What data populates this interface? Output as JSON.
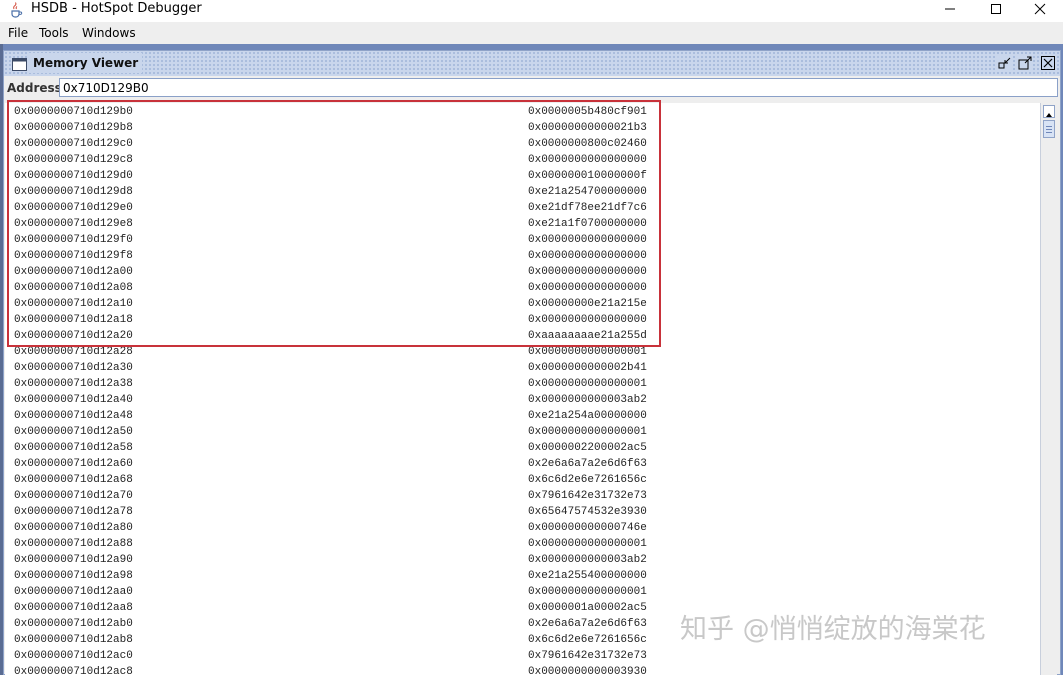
{
  "window": {
    "title": "HSDB - HotSpot Debugger"
  },
  "menu": {
    "items": [
      {
        "label": "File"
      },
      {
        "label": "Tools"
      },
      {
        "label": "Windows"
      }
    ]
  },
  "frame": {
    "title": "Memory Viewer"
  },
  "address": {
    "label": "Address:",
    "value": "0x710D129B0"
  },
  "memory": {
    "rows": [
      {
        "address": "0x0000000710d129b0",
        "value": "0x0000005b480cf901"
      },
      {
        "address": "0x0000000710d129b8",
        "value": "0x00000000000021b3"
      },
      {
        "address": "0x0000000710d129c0",
        "value": "0x0000000800c02460"
      },
      {
        "address": "0x0000000710d129c8",
        "value": "0x0000000000000000"
      },
      {
        "address": "0x0000000710d129d0",
        "value": "0x000000010000000f"
      },
      {
        "address": "0x0000000710d129d8",
        "value": "0xe21a254700000000"
      },
      {
        "address": "0x0000000710d129e0",
        "value": "0xe21df78ee21df7c6"
      },
      {
        "address": "0x0000000710d129e8",
        "value": "0xe21a1f0700000000"
      },
      {
        "address": "0x0000000710d129f0",
        "value": "0x0000000000000000"
      },
      {
        "address": "0x0000000710d129f8",
        "value": "0x0000000000000000"
      },
      {
        "address": "0x0000000710d12a00",
        "value": "0x0000000000000000"
      },
      {
        "address": "0x0000000710d12a08",
        "value": "0x0000000000000000"
      },
      {
        "address": "0x0000000710d12a10",
        "value": "0x00000000e21a215e"
      },
      {
        "address": "0x0000000710d12a18",
        "value": "0x0000000000000000"
      },
      {
        "address": "0x0000000710d12a20",
        "value": "0xaaaaaaaae21a255d"
      },
      {
        "address": "0x0000000710d12a28",
        "value": "0x0000000000000001"
      },
      {
        "address": "0x0000000710d12a30",
        "value": "0x0000000000002b41"
      },
      {
        "address": "0x0000000710d12a38",
        "value": "0x0000000000000001"
      },
      {
        "address": "0x0000000710d12a40",
        "value": "0x0000000000003ab2"
      },
      {
        "address": "0x0000000710d12a48",
        "value": "0xe21a254a00000000"
      },
      {
        "address": "0x0000000710d12a50",
        "value": "0x0000000000000001"
      },
      {
        "address": "0x0000000710d12a58",
        "value": "0x0000002200002ac5"
      },
      {
        "address": "0x0000000710d12a60",
        "value": "0x2e6a6a7a2e6d6f63"
      },
      {
        "address": "0x0000000710d12a68",
        "value": "0x6c6d2e6e7261656c"
      },
      {
        "address": "0x0000000710d12a70",
        "value": "0x7961642e31732e73"
      },
      {
        "address": "0x0000000710d12a78",
        "value": "0x65647574532e3930"
      },
      {
        "address": "0x0000000710d12a80",
        "value": "0x000000000000746e"
      },
      {
        "address": "0x0000000710d12a88",
        "value": "0x0000000000000001"
      },
      {
        "address": "0x0000000710d12a90",
        "value": "0x0000000000003ab2"
      },
      {
        "address": "0x0000000710d12a98",
        "value": "0xe21a255400000000"
      },
      {
        "address": "0x0000000710d12aa0",
        "value": "0x0000000000000001"
      },
      {
        "address": "0x0000000710d12aa8",
        "value": "0x0000001a00002ac5"
      },
      {
        "address": "0x0000000710d12ab0",
        "value": "0x2e6a6a7a2e6d6f63"
      },
      {
        "address": "0x0000000710d12ab8",
        "value": "0x6c6d2e6e7261656c"
      },
      {
        "address": "0x0000000710d12ac0",
        "value": "0x7961642e31732e73"
      },
      {
        "address": "0x0000000710d12ac8",
        "value": "0x0000000000003930"
      }
    ]
  },
  "watermark": {
    "text": "知乎 @悄悄绽放的海棠花"
  },
  "icons": {
    "app": "java-cup-icon",
    "frame": "window-icon",
    "minimize": "minimize-icon",
    "maximize": "maximize-icon",
    "close": "close-icon",
    "frame_iconify": "iconify-icon",
    "frame_maximize": "frame-maximize-icon",
    "frame_close": "frame-close-icon"
  },
  "colors": {
    "desktop": "#6f87b9",
    "frame_title": "#c9d6ec",
    "highlight": "#c8323a"
  }
}
